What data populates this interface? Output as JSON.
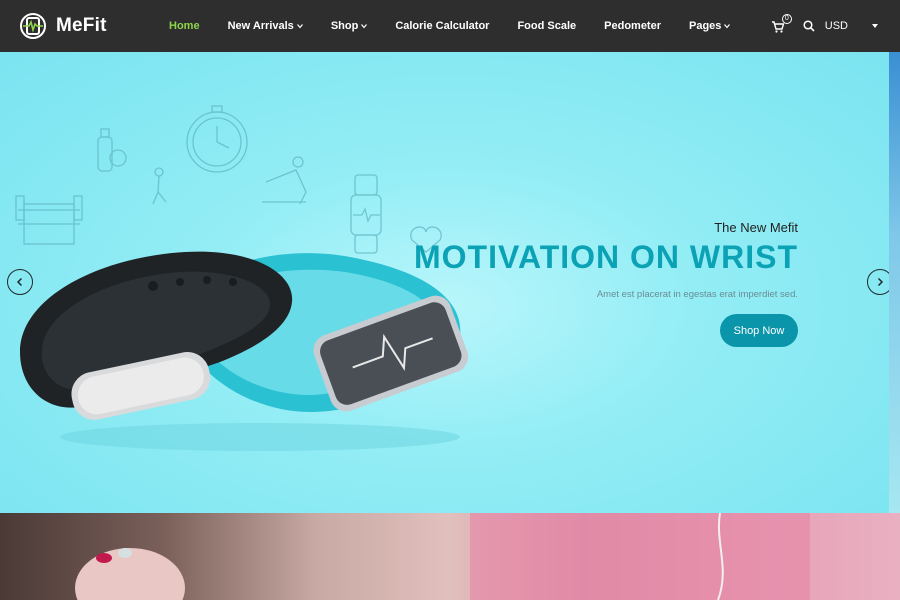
{
  "brand": {
    "name": "MeFit"
  },
  "nav": {
    "items": [
      {
        "label": "Home",
        "active": true,
        "dropdown": false
      },
      {
        "label": "New Arrivals",
        "active": false,
        "dropdown": true
      },
      {
        "label": "Shop",
        "active": false,
        "dropdown": true
      },
      {
        "label": "Calorie Calculator",
        "active": false,
        "dropdown": false
      },
      {
        "label": "Food Scale",
        "active": false,
        "dropdown": false
      },
      {
        "label": "Pedometer",
        "active": false,
        "dropdown": false
      },
      {
        "label": "Pages",
        "active": false,
        "dropdown": true
      }
    ]
  },
  "header": {
    "cart_count": "0",
    "currency": "USD",
    "icons": [
      "cart-icon",
      "search-icon"
    ]
  },
  "hero": {
    "small_title": "The New Mefit",
    "big_title": "MOTIVATION ON WRIST",
    "subtitle": "Amet est placerat in egestas erat imperdiet sed.",
    "cta_label": "Shop Now"
  },
  "colors": {
    "header_bg": "#2e2e2e",
    "nav_active": "#8ed44a",
    "hero_title": "#0ba2b5",
    "cta_bg": "#0b95ab"
  }
}
